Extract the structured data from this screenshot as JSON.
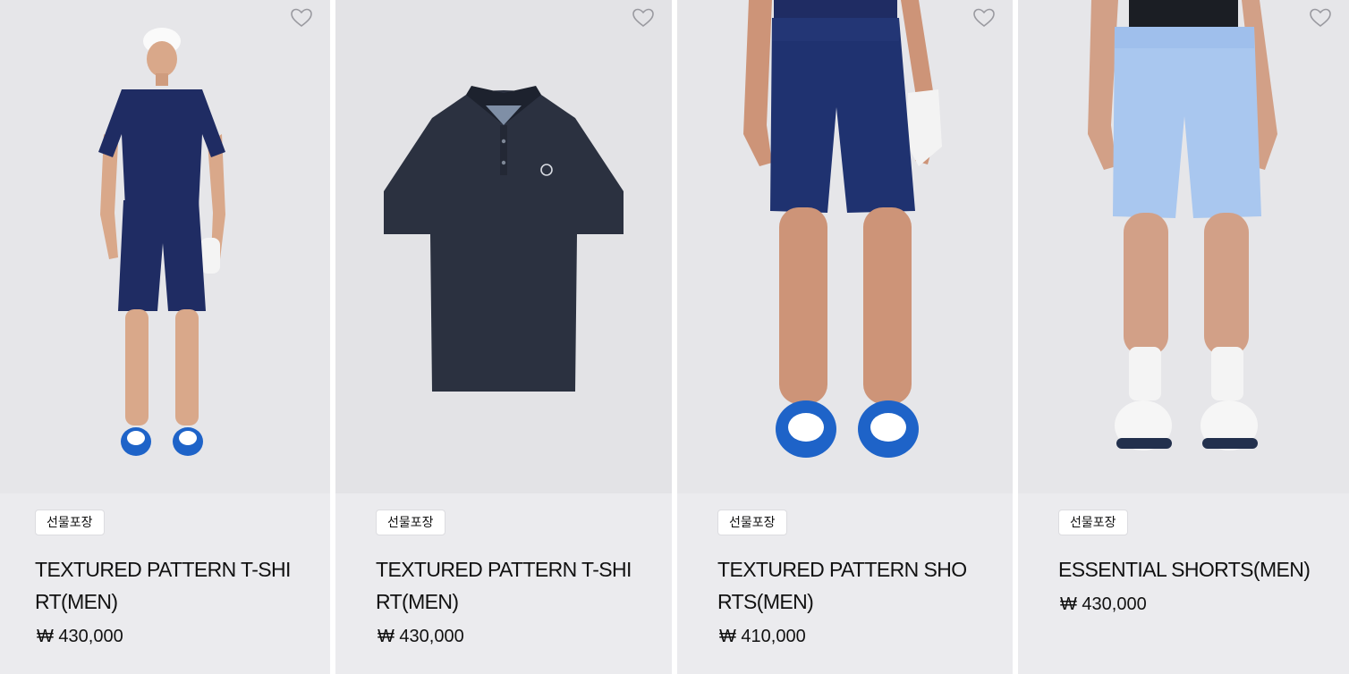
{
  "products": [
    {
      "badge": "선물포장",
      "name": "TEXTURED PATTERN T-SHIRT(MEN)",
      "price": "₩ 430,000",
      "wishlist_icon": "heart-outline-icon"
    },
    {
      "badge": "선물포장",
      "name": "TEXTURED PATTERN T-SHIRT(MEN)",
      "price": "₩ 430,000",
      "wishlist_icon": "heart-outline-icon"
    },
    {
      "badge": "선물포장",
      "name": "TEXTURED PATTERN SHORTS(MEN)",
      "price": "₩ 410,000",
      "wishlist_icon": "heart-outline-icon"
    },
    {
      "badge": "선물포장",
      "name": "ESSENTIAL SHORTS(MEN)",
      "price": "₩ 430,000",
      "wishlist_icon": "heart-outline-icon"
    }
  ],
  "colors": {
    "card_bg": "#ebebee",
    "navy": "#1f2c63",
    "charcoal": "#2b3140",
    "light_blue": "#a9c7ef"
  }
}
